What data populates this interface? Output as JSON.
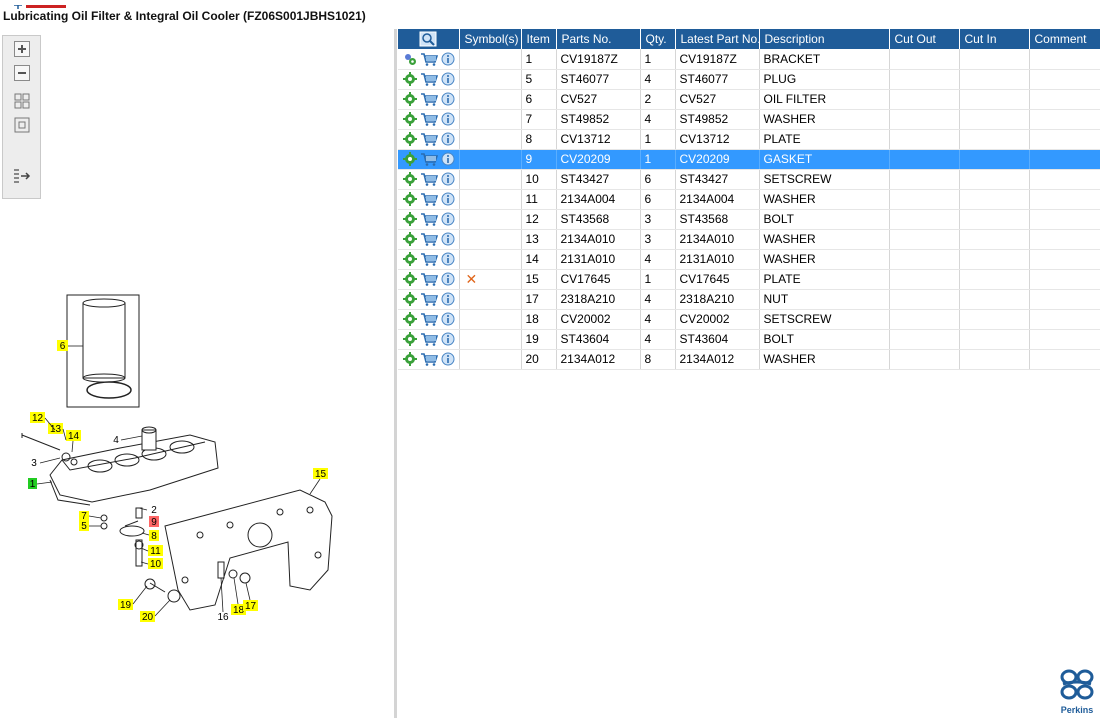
{
  "header": {
    "title": "Lubricating Oil Filter & Integral Oil Cooler (FZ06S001JBHS1021)"
  },
  "table": {
    "columns": [
      "",
      "Symbol(s)",
      "Item",
      "Parts No.",
      "Qty.",
      "Latest Part No.",
      "Description",
      "Cut Out",
      "Cut In",
      "Comment"
    ],
    "rows": [
      {
        "item": "1",
        "part": "CV19187Z",
        "qty": "1",
        "latest": "CV19187Z",
        "desc": "BRACKET",
        "symbol": ""
      },
      {
        "item": "5",
        "part": "ST46077",
        "qty": "4",
        "latest": "ST46077",
        "desc": "PLUG",
        "symbol": ""
      },
      {
        "item": "6",
        "part": "CV527",
        "qty": "2",
        "latest": "CV527",
        "desc": "OIL FILTER",
        "symbol": ""
      },
      {
        "item": "7",
        "part": "ST49852",
        "qty": "4",
        "latest": "ST49852",
        "desc": "WASHER",
        "symbol": ""
      },
      {
        "item": "8",
        "part": "CV13712",
        "qty": "1",
        "latest": "CV13712",
        "desc": "PLATE",
        "symbol": ""
      },
      {
        "item": "9",
        "part": "CV20209",
        "qty": "1",
        "latest": "CV20209",
        "desc": "GASKET",
        "symbol": ""
      },
      {
        "item": "10",
        "part": "ST43427",
        "qty": "6",
        "latest": "ST43427",
        "desc": "SETSCREW",
        "symbol": ""
      },
      {
        "item": "11",
        "part": "2134A004",
        "qty": "6",
        "latest": "2134A004",
        "desc": "WASHER",
        "symbol": ""
      },
      {
        "item": "12",
        "part": "ST43568",
        "qty": "3",
        "latest": "ST43568",
        "desc": "BOLT",
        "symbol": ""
      },
      {
        "item": "13",
        "part": "2134A010",
        "qty": "3",
        "latest": "2134A010",
        "desc": "WASHER",
        "symbol": ""
      },
      {
        "item": "14",
        "part": "2131A010",
        "qty": "4",
        "latest": "2131A010",
        "desc": "WASHER",
        "symbol": ""
      },
      {
        "item": "15",
        "part": "CV17645",
        "qty": "1",
        "latest": "CV17645",
        "desc": "PLATE",
        "symbol": "✕"
      },
      {
        "item": "17",
        "part": "2318A210",
        "qty": "4",
        "latest": "2318A210",
        "desc": "NUT",
        "symbol": ""
      },
      {
        "item": "18",
        "part": "CV20002",
        "qty": "4",
        "latest": "CV20002",
        "desc": "SETSCREW",
        "symbol": ""
      },
      {
        "item": "19",
        "part": "ST43604",
        "qty": "4",
        "latest": "ST43604",
        "desc": "BOLT",
        "symbol": ""
      },
      {
        "item": "20",
        "part": "2134A012",
        "qty": "8",
        "latest": "2134A012",
        "desc": "WASHER",
        "symbol": ""
      }
    ],
    "selected_item": "9"
  },
  "diagram": {
    "callouts": [
      {
        "label": "6",
        "style": "yellow"
      },
      {
        "label": "12",
        "style": "yellow"
      },
      {
        "label": "13",
        "style": "yellow"
      },
      {
        "label": "14",
        "style": "yellow"
      },
      {
        "label": "4",
        "style": "plain"
      },
      {
        "label": "3",
        "style": "plain"
      },
      {
        "label": "1",
        "style": "green"
      },
      {
        "label": "15",
        "style": "yellow"
      },
      {
        "label": "2",
        "style": "plain"
      },
      {
        "label": "9",
        "style": "red"
      },
      {
        "label": "7",
        "style": "yellow"
      },
      {
        "label": "5",
        "style": "yellow"
      },
      {
        "label": "8",
        "style": "yellow"
      },
      {
        "label": "11",
        "style": "yellow"
      },
      {
        "label": "10",
        "style": "yellow"
      },
      {
        "label": "19",
        "style": "yellow"
      },
      {
        "label": "20",
        "style": "yellow"
      },
      {
        "label": "16",
        "style": "plain"
      },
      {
        "label": "18",
        "style": "yellow"
      },
      {
        "label": "17",
        "style": "yellow"
      }
    ]
  },
  "brand": {
    "name": "Perkins",
    "color": "#1f5c99"
  },
  "colors": {
    "header": "#1f5c99",
    "selection": "#3399ff",
    "callout_yellow": "#ffff00",
    "callout_green": "#22cc22",
    "callout_red": "#ff6666"
  },
  "icons": {
    "toolbar": [
      "zoom-in-icon",
      "zoom-out-icon",
      "fit-all-icon",
      "fit-window-icon",
      "export-icon"
    ],
    "row_actions": [
      "gear-icon",
      "cart-icon",
      "info-icon"
    ],
    "table_header": "search-view-icon"
  }
}
